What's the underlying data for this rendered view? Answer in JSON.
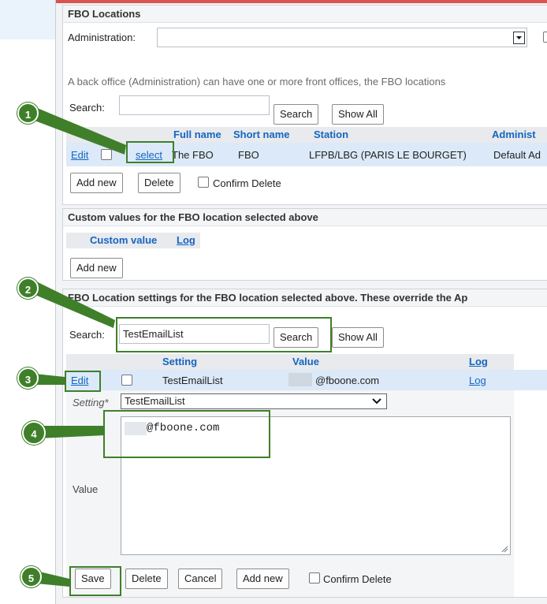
{
  "fbo_locations": {
    "title": "FBO Locations",
    "admin_label": "Administration:",
    "admin_value": "",
    "info_text": "A back office (Administration) can have one or more front offices, the FBO locations",
    "search_label": "Search:",
    "search_value": "",
    "search_button": "Search",
    "show_all_button": "Show All",
    "columns": [
      "Full name",
      "Short name",
      "Station",
      "Administ"
    ],
    "row": {
      "edit": "Edit",
      "select": "select",
      "full_name": "The FBO",
      "short_name": "FBO",
      "station": "LFPB/LBG (PARIS LE BOURGET)",
      "administration": "Default Ad"
    },
    "add_new_button": "Add new",
    "delete_button": "Delete",
    "confirm_delete_label": "Confirm Delete"
  },
  "custom_values": {
    "title": "Custom values for the FBO location selected above",
    "col_custom_value": "Custom value",
    "col_log": "Log",
    "add_new_button": "Add new"
  },
  "settings": {
    "title": "FBO Location settings for the FBO location selected above. These override the Ap",
    "search_label": "Search:",
    "search_value": "TestEmailList",
    "search_button": "Search",
    "show_all_button": "Show All",
    "columns": {
      "setting": "Setting",
      "value": "Value",
      "log": "Log"
    },
    "row": {
      "edit": "Edit",
      "setting": "TestEmailList",
      "value": "@fboone.com",
      "log": "Log"
    },
    "editor": {
      "setting_label": "Setting*",
      "setting_value": "TestEmailList",
      "value_label": "Value",
      "value_text": "@fboone.com"
    },
    "buttons": {
      "save": "Save",
      "delete": "Delete",
      "cancel": "Cancel",
      "add_new": "Add new",
      "confirm_delete": "Confirm Delete"
    }
  },
  "callouts": [
    "1",
    "2",
    "3",
    "4",
    "5"
  ],
  "colors": {
    "callout_green": "#3f7f2a",
    "link_blue": "#1565c0",
    "selected_row": "#dce9f8",
    "header_row": "#e8eaed",
    "top_bar": "#d9534f"
  }
}
